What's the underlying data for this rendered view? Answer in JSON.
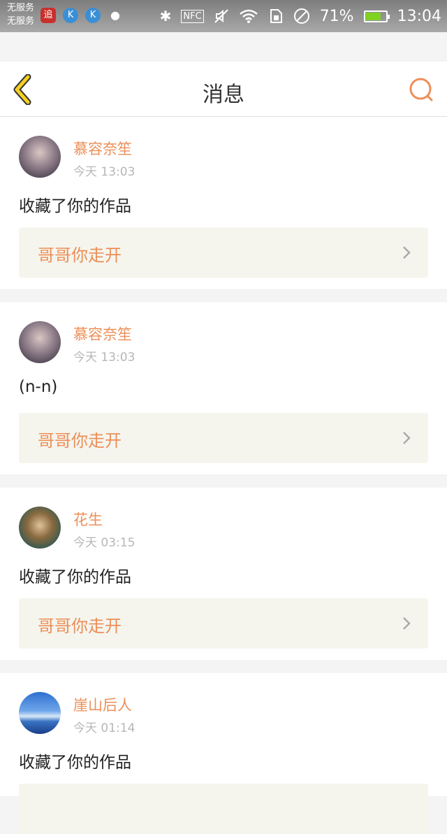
{
  "status_bar": {
    "carrier_line1": "无服务",
    "carrier_line2": "无服务",
    "app_icons": [
      "追",
      "K",
      "K"
    ],
    "nfc": "NFC",
    "battery": "71%",
    "time": "13:04"
  },
  "header": {
    "title": "消息",
    "back_icon": "chevron-left-icon",
    "search_icon": "search-icon",
    "accent": "#ec8f58"
  },
  "messages": [
    {
      "user": "慕容奈笙",
      "time": "今天 13:03",
      "text": "收藏了你的作品",
      "work": "哥哥你走开",
      "avatar": "girl-portrait"
    },
    {
      "user": "慕容奈笙",
      "time": "今天 13:03",
      "text": "(n-n)",
      "work": "哥哥你走开",
      "avatar": "girl-portrait"
    },
    {
      "user": "花生",
      "time": "今天 03:15",
      "text": "收藏了你的作品",
      "work": "哥哥你走开",
      "avatar": "warrior-portrait"
    },
    {
      "user": "崖山后人",
      "time": "今天 01:14",
      "text": "收藏了你的作品",
      "work": "",
      "avatar": "sky-landscape"
    }
  ]
}
